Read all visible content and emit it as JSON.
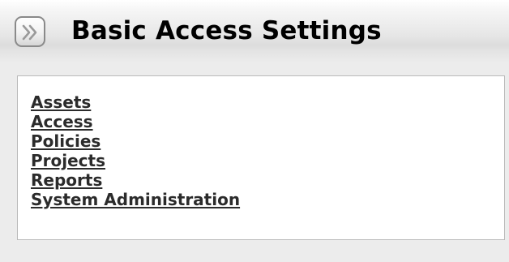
{
  "header": {
    "title": "Basic Access Settings",
    "collapse_icon": "double-chevron-right-icon"
  },
  "menu": {
    "items": [
      {
        "label": "Assets"
      },
      {
        "label": "Access"
      },
      {
        "label": "Policies"
      },
      {
        "label": "Projects"
      },
      {
        "label": "Reports"
      },
      {
        "label": "System Administration"
      }
    ]
  },
  "colors": {
    "background": "#ececec",
    "content_background": "#ffffff",
    "link": "#2b2b2b",
    "border": "#b9b9b9"
  }
}
